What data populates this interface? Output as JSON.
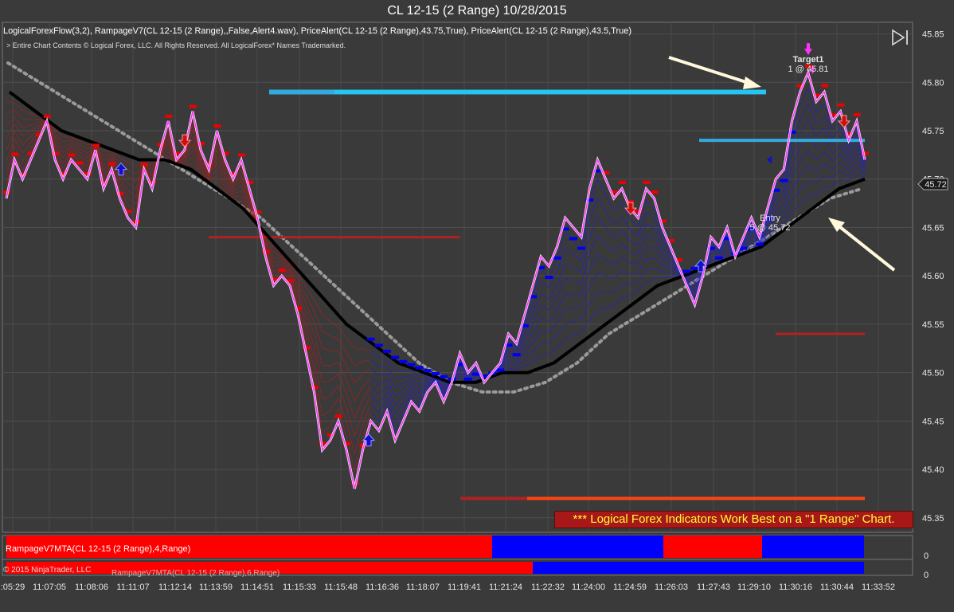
{
  "window": {
    "title": "CL 12-15 (2 Range)  10/28/2015"
  },
  "header": {
    "indicators": "LogicalForexFlow(3,2),  RampageV7(CL 12-15 (2 Range),,False,Alert4.wav), PriceAlert(CL 12-15 (2 Range),43.75,True), PriceAlert(CL 12-15 (2 Range),43.5,True)",
    "copyright": "> Entire Chart Contents © Logical Forex, LLC. All Rights Reserved. All LogicalForex* Names Trademarked."
  },
  "icons": {
    "play_to_end": "skip-to-end-icon"
  },
  "annotations": {
    "target_label": "Target1",
    "target_value": "1 @ 45.81",
    "entry_label": "Entry",
    "entry_value": "5 @ 45.72",
    "current_price": "45.72",
    "warning": "*** Logical Forex Indicators Work Best on a \"1 Range\" Chart."
  },
  "subpanel": {
    "label1": "RampageV7MTA(CL 12-15 (2 Range),4,Range)",
    "label2": "RampageV7MTA(CL 12-15 (2 Range),6,Range)",
    "ninja_copyright": "© 2015 NinjaTrader, LLC",
    "zero1": "0",
    "zero2": "0"
  },
  "colors": {
    "background": "#3a3a3a",
    "price_line": "#ff33ff",
    "slow_ma": "#000000",
    "dotted_ma": "#9a9a9a",
    "bull": "#0000ee",
    "bear": "#ee0000",
    "level_blue": "#33aadd",
    "level_red": "#b02222",
    "target_magenta": "#ff33ff",
    "arrow_cream": "#fff8dc"
  },
  "chart_data": {
    "type": "line",
    "title": "CL 12-15 (2 Range)  10/28/2015",
    "y_ticks": [
      "45.85",
      "45.80",
      "45.75",
      "45.70",
      "45.65",
      "45.60",
      "45.55",
      "45.50",
      "45.45",
      "45.40",
      "45.35"
    ],
    "ylim": [
      45.335,
      45.862
    ],
    "x_ticks": [
      ":05:29",
      "11:07:05",
      "11:08:06",
      "11:11:07",
      "11:12:14",
      "11:13:59",
      "11:14:51",
      "11:15:33",
      "11:15:48",
      "11:16:36",
      "11:18:07",
      "11:19:41",
      "11:21:24",
      "11:22:32",
      "11:24:00",
      "11:24:59",
      "11:26:03",
      "11:27:43",
      "11:29:10",
      "11:30:16",
      "11:30:44",
      "11:33:52"
    ],
    "grid": true,
    "series": [
      {
        "name": "Price",
        "values": [
          45.68,
          45.72,
          45.7,
          45.72,
          45.74,
          45.76,
          45.72,
          45.7,
          45.72,
          45.71,
          45.7,
          45.73,
          45.69,
          45.71,
          45.68,
          45.66,
          45.65,
          45.71,
          45.69,
          45.73,
          45.76,
          45.72,
          45.73,
          45.77,
          45.73,
          45.71,
          45.75,
          45.72,
          45.7,
          45.72,
          45.69,
          45.66,
          45.62,
          45.59,
          45.6,
          45.59,
          45.56,
          45.52,
          45.48,
          45.42,
          45.43,
          45.45,
          45.42,
          45.38,
          45.42,
          45.45,
          45.44,
          45.46,
          45.43,
          45.45,
          45.47,
          45.46,
          45.48,
          45.49,
          45.47,
          45.49,
          45.52,
          45.5,
          45.51,
          45.49,
          45.5,
          45.51,
          45.54,
          45.53,
          45.56,
          45.59,
          45.62,
          45.61,
          45.63,
          45.66,
          45.65,
          45.64,
          45.69,
          45.72,
          45.7,
          45.68,
          45.69,
          45.67,
          45.66,
          45.69,
          45.68,
          45.65,
          45.63,
          45.61,
          45.59,
          45.57,
          45.6,
          45.64,
          45.63,
          45.65,
          45.62,
          45.64,
          45.66,
          45.64,
          45.67,
          45.7,
          45.71,
          45.76,
          45.79,
          45.81,
          45.78,
          45.79,
          45.76,
          45.77,
          45.74,
          45.76,
          45.72
        ]
      },
      {
        "name": "Slow MA",
        "values": [
          45.79,
          45.77,
          45.75,
          45.74,
          45.73,
          45.72,
          45.72,
          45.71,
          45.69,
          45.67,
          45.64,
          45.61,
          45.58,
          45.55,
          45.53,
          45.51,
          45.5,
          45.49,
          45.49,
          45.5,
          45.5,
          45.51,
          45.53,
          45.55,
          45.57,
          45.59,
          45.6,
          45.61,
          45.62,
          45.63,
          45.65,
          45.67,
          45.69,
          45.7
        ]
      },
      {
        "name": "Dotted MA",
        "values": [
          45.82,
          45.8,
          45.78,
          45.76,
          45.74,
          45.72,
          45.7,
          45.68,
          45.66,
          45.63,
          45.6,
          45.57,
          45.54,
          45.51,
          45.49,
          45.48,
          45.48,
          45.49,
          45.51,
          45.54,
          45.56,
          45.58,
          45.6,
          45.62,
          45.64,
          45.66,
          45.68,
          45.69
        ]
      }
    ],
    "levels": [
      {
        "price": 45.79,
        "color": "#33aadd"
      },
      {
        "price": 45.74,
        "color": "#33aadd"
      },
      {
        "price": 45.64,
        "color": "#b02222"
      },
      {
        "price": 45.54,
        "color": "#b02222"
      },
      {
        "price": 45.37,
        "color": "#b02222"
      }
    ],
    "markers": [
      {
        "type": "buy-arrow",
        "price": 45.71
      },
      {
        "type": "sell-arrow",
        "price": 45.74
      },
      {
        "type": "buy-arrow",
        "price": 45.43
      },
      {
        "type": "sell-arrow",
        "price": 45.67
      },
      {
        "type": "buy-arrow",
        "price": 45.61
      },
      {
        "type": "sell-arrow",
        "price": 45.76
      },
      {
        "type": "target",
        "price": 45.81
      },
      {
        "type": "entry",
        "price": 45.72
      }
    ]
  }
}
